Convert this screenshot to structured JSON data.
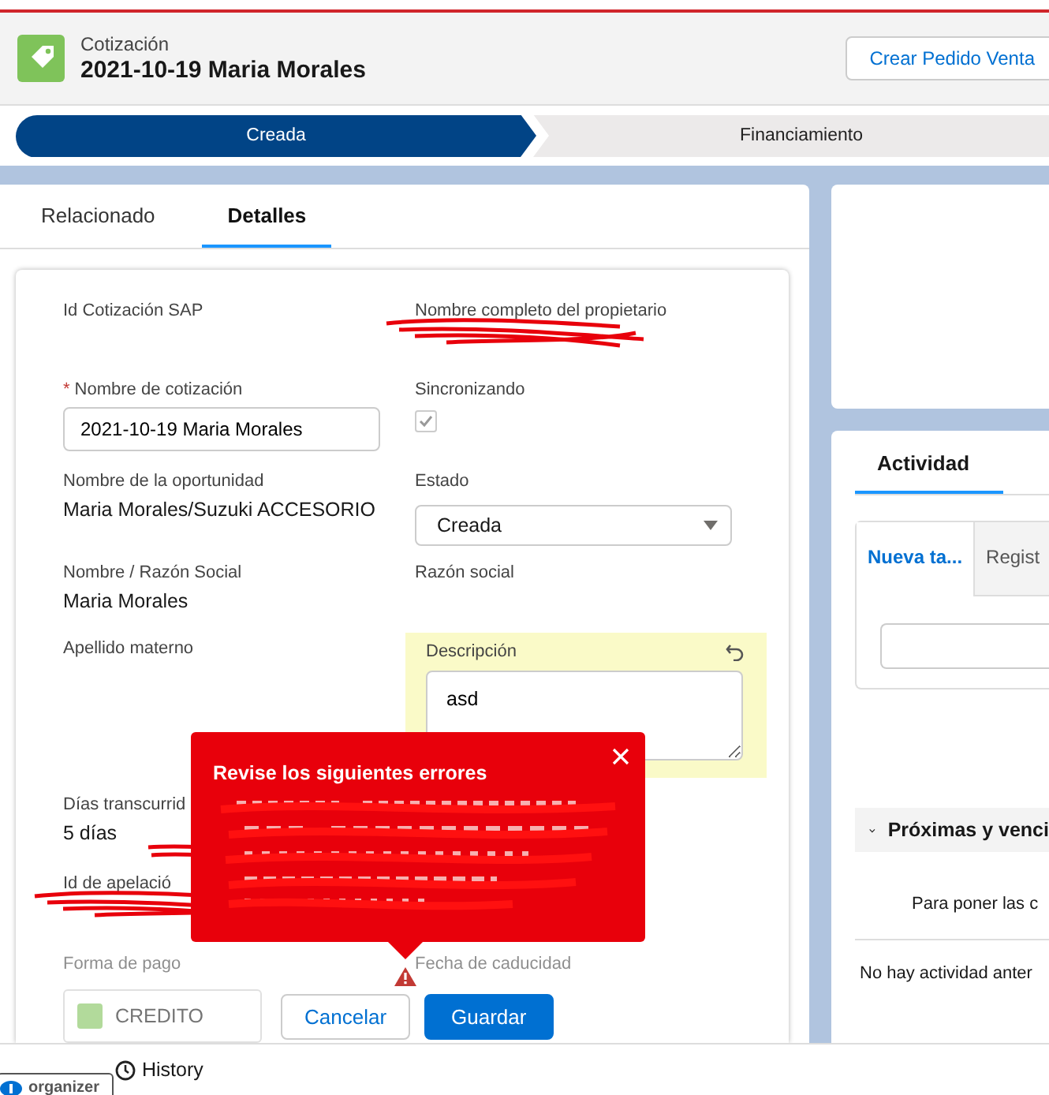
{
  "record_header": {
    "object_type": "Cotización",
    "title": "2021-10-19 Maria Morales",
    "action_button": "Crear Pedido Venta"
  },
  "path": [
    {
      "label": "Creada",
      "selected": true
    },
    {
      "label": "Financiamiento",
      "selected": false
    }
  ],
  "tabs": [
    {
      "label": "Relacionado",
      "selected": false
    },
    {
      "label": "Detalles",
      "selected": true
    }
  ],
  "field_rows": [
    {
      "left": {
        "kind": "text",
        "label": "Id Cotización SAP"
      },
      "right": {
        "kind": "redacted",
        "label": "Nombre completo del propietario"
      }
    },
    {
      "left": {
        "kind": "input",
        "label": "Nombre de cotización",
        "required_mark": "*",
        "value": "2021-10-19 Maria Morales"
      },
      "right": {
        "kind": "checkbox",
        "label": "Sincronizando",
        "checked": true
      }
    },
    {
      "left": {
        "kind": "text",
        "label": "Nombre de la oportunidad",
        "value": "Maria Morales/Suzuki ACCESORIO"
      },
      "right": {
        "kind": "select",
        "label": "Estado",
        "value": "Creada"
      }
    },
    {
      "left": {
        "kind": "text",
        "label": "Nombre / Razón Social",
        "value": "Maria Morales"
      },
      "right": {
        "kind": "text",
        "label": "Razón social"
      }
    },
    {
      "left": {
        "kind": "text",
        "label": "Apellido materno"
      },
      "right": {
        "kind": "textarea",
        "label": "Descripción",
        "value": "asd",
        "edited": true
      }
    },
    {
      "left": {
        "kind": "text",
        "label": "Días transcurrid",
        "value": "5 días"
      }
    },
    {
      "left": {
        "kind": "redacted",
        "label": "Id de apelació"
      }
    },
    {
      "left": {
        "kind": "picklist",
        "label": "Forma de pago",
        "value": "CREDITO",
        "faded": true
      },
      "right": {
        "kind": "text",
        "label": "Fecha de caducidad",
        "faded": true
      }
    }
  ],
  "error_popup": {
    "title": "Revise los siguientes errores"
  },
  "form_buttons": [
    {
      "label": "Cancelar",
      "kind": "neutral"
    },
    {
      "label": "Guardar",
      "kind": "brand"
    }
  ],
  "activity": {
    "tabs": [
      {
        "label": "Actividad",
        "selected": true
      }
    ],
    "subtabs": [
      {
        "label": "Nueva ta...",
        "selected": true
      },
      {
        "label": "Regist",
        "selected": false
      }
    ],
    "section": "Próximas y venci",
    "upcoming_text": "Para poner las c",
    "past_text": "No hay actividad anter"
  },
  "footer": {
    "history": "History",
    "badge": "organizer"
  }
}
